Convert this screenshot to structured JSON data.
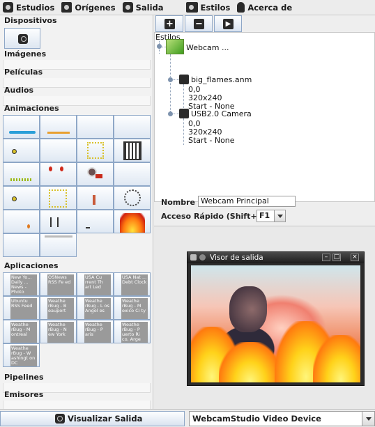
{
  "menubar": {
    "items": [
      {
        "label": "Estudios",
        "icon": "camera-icon"
      },
      {
        "label": "Orígenes",
        "icon": "monitor-icon"
      },
      {
        "label": "Salida",
        "icon": "camera-icon"
      },
      {
        "label": "Estilos",
        "icon": "toolbox-icon"
      },
      {
        "label": "Acerca de",
        "icon": "person-icon"
      }
    ]
  },
  "sidebar": {
    "sections": {
      "dispositivos": "Dispositivos",
      "imagenes": "Imágenes",
      "peliculas": "Películas",
      "audios": "Audios",
      "animaciones": "Animaciones",
      "aplicaciones": "Aplicaciones",
      "pipelines": "Pipelines",
      "emisores": "Emisores"
    },
    "applications": [
      "New Yo... Daily ... News - Photo",
      "OSNews RSS Fe ed",
      "USA Cu rrent Th art Led",
      "USA Nat ... Debt Clock",
      "Ubuntu RSS Feed",
      "Weathe rBug - B eauport",
      "Weathe rBug - L os Angel es",
      "Weathe rBug - M exico Ci ty",
      "Weathe rBug - M ontreal",
      "Weathe rBug - N ew York",
      "Weathe rBug - P aris",
      "Weathe rBug - P uerto Ri co, Arge",
      "Weathe rBug - W ashingt on DC"
    ]
  },
  "toolbar": {
    "add": "+",
    "remove": "−",
    "play": "▶"
  },
  "tree": {
    "root": "Estilos",
    "source": "Webcam ...",
    "children": [
      {
        "name": "big_flames.anm",
        "lines": [
          "0,0",
          "320x240",
          "Start - None"
        ]
      },
      {
        "name": "USB2.0 Camera",
        "lines": [
          "0,0",
          "320x240",
          "Start - None"
        ]
      }
    ]
  },
  "form": {
    "nombre_label": "Nombre",
    "nombre_value": "Webcam Principal",
    "acceso_label": "Acceso Rápido (Shift+)",
    "acceso_value": "F1"
  },
  "viewer": {
    "title": "Visor de salida"
  },
  "bottom": {
    "visualizar": "Visualizar Salida",
    "device": "WebcamStudio Video Device"
  },
  "colors": {
    "button_border": "#8ea7c7",
    "tree_line": "#8ea0b8",
    "window_title": "#1d1d1d"
  }
}
